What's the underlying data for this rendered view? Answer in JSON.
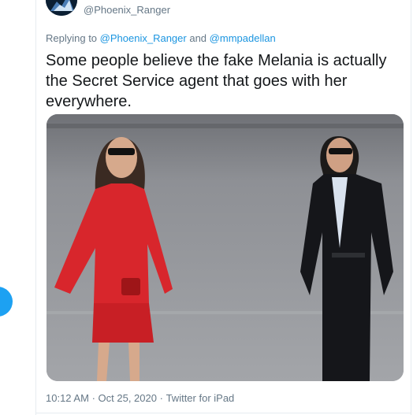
{
  "tweet": {
    "author_handle": "@Phoenix_Ranger",
    "replying": {
      "prefix": "Replying to",
      "mention_1": "@Phoenix_Ranger",
      "joiner": "and",
      "mention_2": "@mmpadellan"
    },
    "text": "Some people believe the fake Melania is actually the Secret Service agent that goes with her everywhere.",
    "time": "10:12 AM",
    "separator": "·",
    "date": "Oct 25, 2020",
    "source": "Twitter for iPad"
  },
  "colors": {
    "accent": "#1da1f2",
    "link": "#1b95e0",
    "muted": "#657786",
    "text": "#14171a",
    "dress_red": "#d8262c",
    "suit_black": "#15161a",
    "tarmac": "#8d8f94"
  }
}
